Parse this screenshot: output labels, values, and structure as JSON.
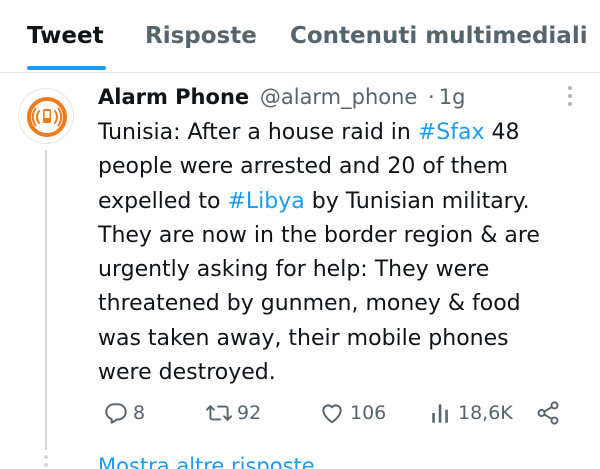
{
  "tabs": [
    {
      "label": "Tweet",
      "active": true
    },
    {
      "label": "Risposte",
      "active": false
    },
    {
      "label": "Contenuti multimediali",
      "active": false
    }
  ],
  "tweet": {
    "author_name": "Alarm Phone",
    "author_handle": "@alarm_phone",
    "separator": "·",
    "time": "1g",
    "text_lines": [
      [
        "Tunisia: After a house raid in ",
        "#Sfax",
        " 48"
      ],
      [
        "people were arrested and 20 of them"
      ],
      [
        "expelled to ",
        "#Libya",
        " by Tunisian military."
      ],
      [
        "They are now in the border region & are"
      ],
      [
        "urgently asking for help: They were"
      ],
      [
        "threatened by gunmen, money & food"
      ],
      [
        "was taken away, their mobile phones"
      ],
      [
        "were destroyed."
      ]
    ],
    "hashtags": [
      "#Sfax",
      "#Libya"
    ]
  },
  "actions": {
    "replies": "8",
    "retweets": "92",
    "likes": "106",
    "views": "18,6K"
  },
  "show_more_label": "Mostra altre risposte",
  "icons": {
    "avatar": "alarm-phone-logo-icon",
    "more": "more-vertical-icon",
    "reply": "reply-icon",
    "retweet": "retweet-icon",
    "like": "heart-icon",
    "views": "views-chart-icon",
    "share": "share-icon"
  },
  "colors": {
    "accent": "#1d9bf0",
    "text": "#0f1419",
    "secondary": "#56646e",
    "brand_orange": "#f07a1e"
  }
}
